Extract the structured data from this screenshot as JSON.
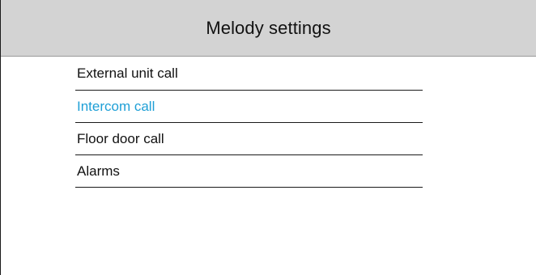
{
  "header": {
    "title": "Melody settings"
  },
  "menu": {
    "selected_index": 1,
    "accent_color": "#1e9fd6",
    "items": [
      {
        "label": "External unit call"
      },
      {
        "label": "Intercom call"
      },
      {
        "label": "Floor door call"
      },
      {
        "label": "Alarms"
      }
    ]
  }
}
